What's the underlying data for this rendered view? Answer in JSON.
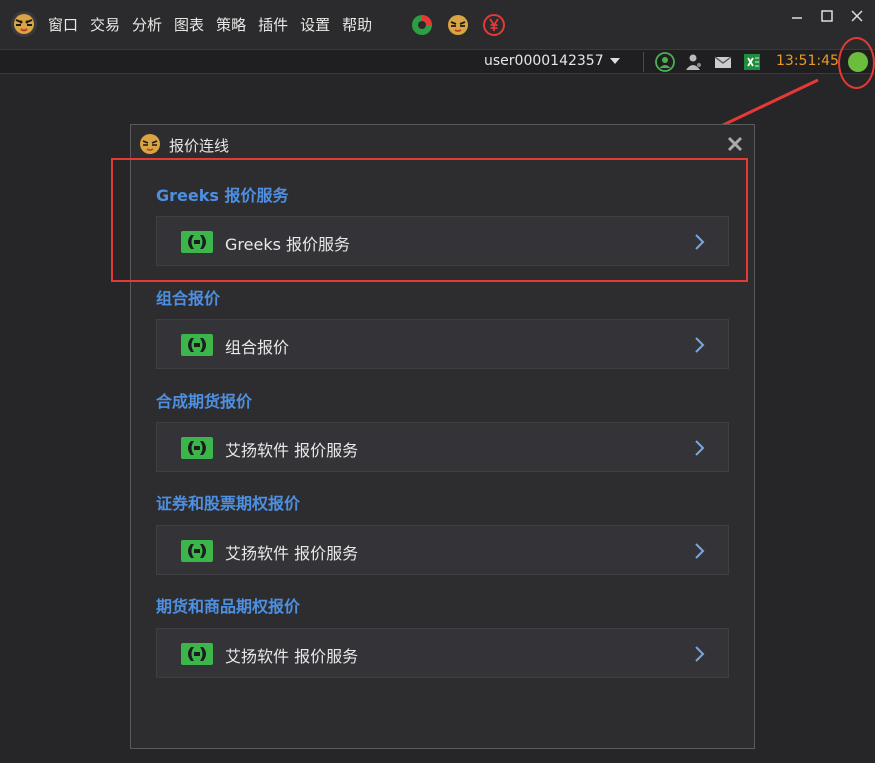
{
  "menubar": {
    "items": [
      "窗口",
      "交易",
      "分析",
      "图表",
      "策略",
      "插件",
      "设置",
      "帮助"
    ]
  },
  "statusbar": {
    "username": "user0000142357",
    "time": "13:51:45"
  },
  "dialog": {
    "title": "报价连线",
    "sections": [
      {
        "title": "Greeks 报价服务",
        "row_label": "Greeks 报价服务"
      },
      {
        "title": "组合报价",
        "row_label": "组合报价"
      },
      {
        "title": "合成期货报价",
        "row_label": "艾扬软件 报价服务"
      },
      {
        "title": "证券和股票期权报价",
        "row_label": "艾扬软件 报价服务"
      },
      {
        "title": "期货和商品期权报价",
        "row_label": "艾扬软件 报价服务"
      }
    ]
  },
  "colors": {
    "accent_blue": "#4e8fe0",
    "status_green": "#6cbc3e",
    "clock_orange": "#e89a2a",
    "annotation_red": "#e53935"
  },
  "icons": {
    "app_logo": "tiger-logo-icon",
    "quick": [
      "pie-chart-icon",
      "tiger-icon",
      "yen-icon"
    ],
    "status": [
      "user-icon",
      "users-icon",
      "mail-icon",
      "excel-icon"
    ],
    "row": "connection-plug-icon",
    "chevron": "chevron-right-icon"
  }
}
